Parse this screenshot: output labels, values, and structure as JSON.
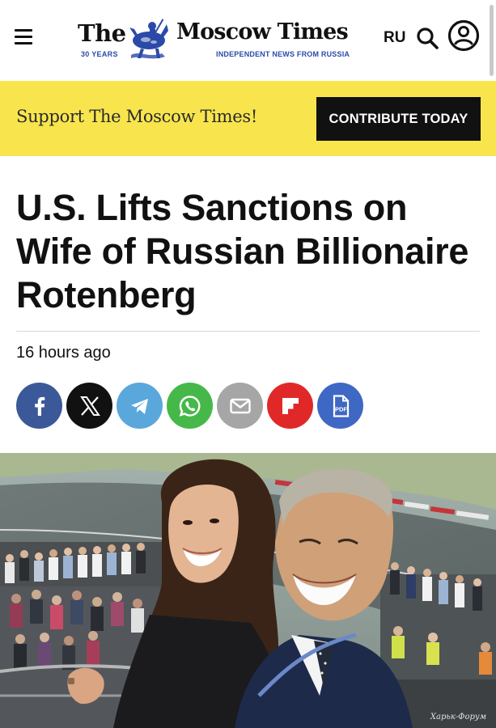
{
  "header": {
    "logo_the": "The",
    "logo_name": "Moscow Times",
    "logo_years": "30 YEARS",
    "logo_tagline": "INDEPENDENT NEWS FROM RUSSIA",
    "language_label": "RU",
    "icons": [
      "menu-icon",
      "search-icon",
      "account-icon"
    ]
  },
  "banner": {
    "support_text": "Support The Moscow Times!",
    "contribute_label": "CONTRIBUTE TODAY"
  },
  "article": {
    "headline": "U.S. Lifts Sanctions on Wife of Russian Billionaire Rotenberg",
    "timestamp": "16 hours ago"
  },
  "share": [
    {
      "network": "facebook",
      "icon": "facebook-icon",
      "color": "#3b5998"
    },
    {
      "network": "x",
      "icon": "x-icon",
      "color": "#111111"
    },
    {
      "network": "telegram",
      "icon": "telegram-icon",
      "color": "#5aa7dc"
    },
    {
      "network": "whatsapp",
      "icon": "whatsapp-icon",
      "color": "#46b84a"
    },
    {
      "network": "email",
      "icon": "email-icon",
      "color": "#a6a6a6"
    },
    {
      "network": "flipboard",
      "icon": "flipboard-icon",
      "color": "#e12828"
    },
    {
      "network": "pdf",
      "icon": "pdf-icon",
      "color": "#3f68c4",
      "label": "PDF"
    }
  ],
  "photo": {
    "watermark": "Харьк-Форум"
  },
  "colors": {
    "banner_bg": "#f8e54e",
    "brand_blue": "#2b4aa8",
    "button_dark": "#111111"
  }
}
